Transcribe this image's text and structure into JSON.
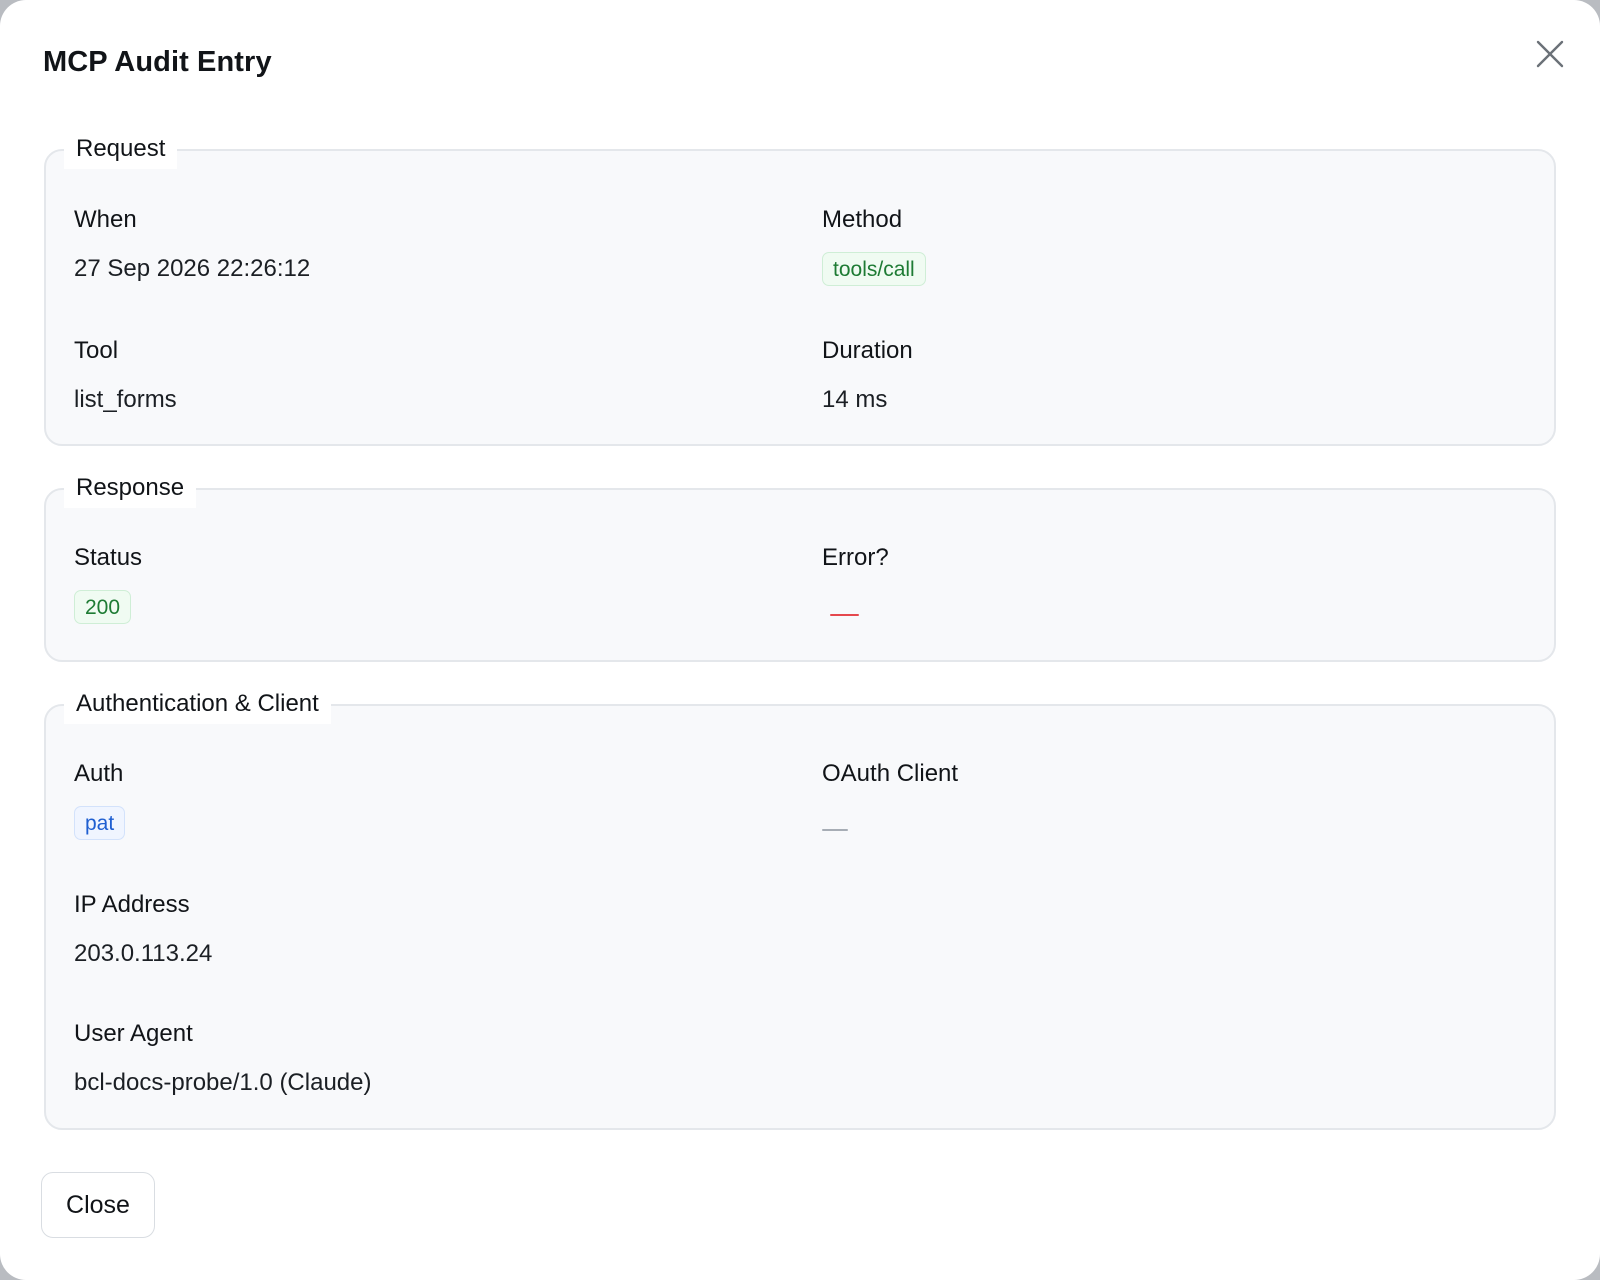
{
  "dialog": {
    "title": "MCP Audit Entry",
    "close_icon": "close-icon"
  },
  "request": {
    "legend": "Request",
    "when_label": "When",
    "when_value": "27 Sep 2026 22:26:12",
    "method_label": "Method",
    "method_value": "tools/call",
    "tool_label": "Tool",
    "tool_value": "list_forms",
    "duration_label": "Duration",
    "duration_value": "14 ms"
  },
  "response": {
    "legend": "Response",
    "status_label": "Status",
    "status_value": "200",
    "error_label": "Error?",
    "error_value_color": "#e5484d"
  },
  "auth": {
    "legend": "Authentication & Client",
    "auth_label": "Auth",
    "auth_value": "pat",
    "oauth_label": "OAuth Client",
    "oauth_value_color": "#a7adb5",
    "ip_label": "IP Address",
    "ip_value": "203.0.113.24",
    "ua_label": "User Agent",
    "ua_value": "bcl-docs-probe/1.0 (Claude)"
  },
  "footer": {
    "close_label": "Close"
  },
  "colors": {
    "success_green": "#1e7b34",
    "info_blue": "#1f5fd1",
    "error_red": "#e5484d"
  }
}
